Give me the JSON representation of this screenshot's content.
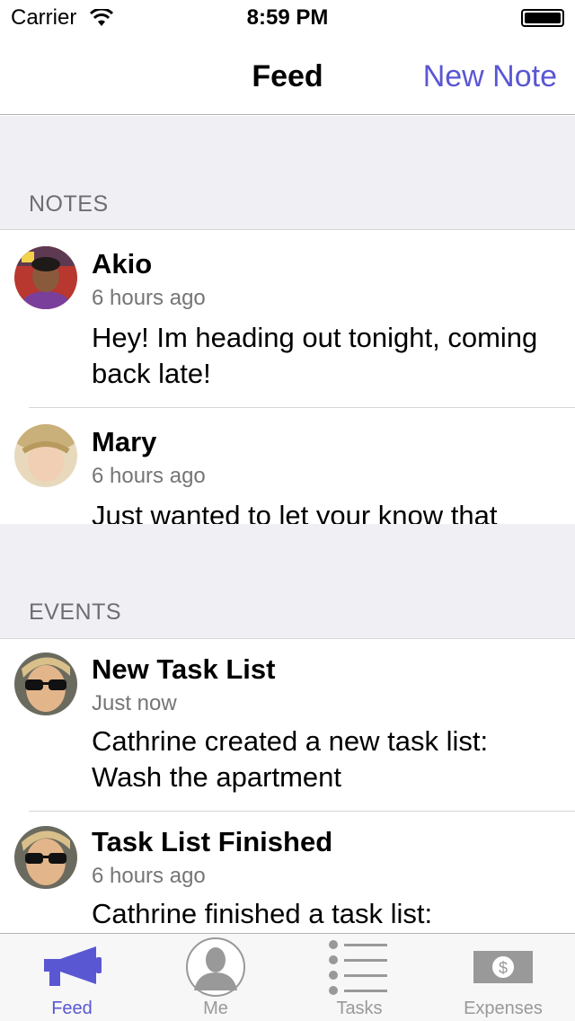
{
  "status_bar": {
    "carrier": "Carrier",
    "time": "8:59 PM"
  },
  "nav": {
    "title": "Feed",
    "action": "New Note"
  },
  "sections": {
    "notes": {
      "header": "NOTES",
      "items": [
        {
          "title": "Akio",
          "time": "6 hours ago",
          "body": "Hey! Im heading out tonight, coming back late!"
        },
        {
          "title": "Mary",
          "time": "6 hours ago",
          "body": "Just wanted to let your know that"
        }
      ]
    },
    "events": {
      "header": "EVENTS",
      "items": [
        {
          "title": "New Task List",
          "time": "Just now",
          "body": "Cathrine created a new task list: Wash the apartment"
        },
        {
          "title": "Task List Finished",
          "time": "6 hours ago",
          "body": "Cathrine finished a task list:"
        }
      ]
    }
  },
  "tabs": [
    {
      "label": "Feed",
      "icon": "megaphone-icon",
      "active": true
    },
    {
      "label": "Me",
      "icon": "person-icon",
      "active": false
    },
    {
      "label": "Tasks",
      "icon": "list-icon",
      "active": false
    },
    {
      "label": "Expenses",
      "icon": "dollar-bill-icon",
      "active": false
    }
  ],
  "colors": {
    "accent": "#5a57d2",
    "section_bg": "#efeff4",
    "inactive_tab": "#999999"
  }
}
